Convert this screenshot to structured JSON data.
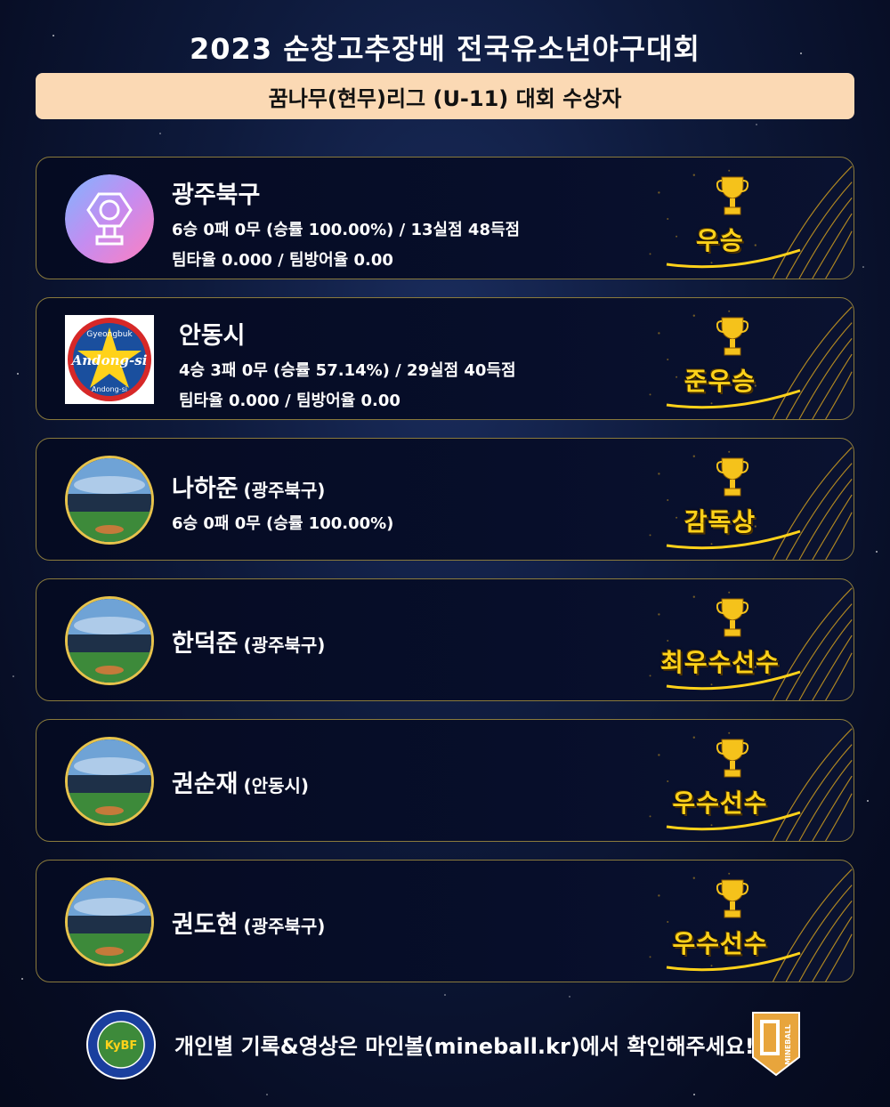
{
  "title": "2023 순창고추장배 전국유소년야구대회",
  "subtitle": "꿈나무(현무)리그 (U-11) 대회 수상자",
  "awards": [
    {
      "name": "광주북구",
      "team": "",
      "line1": "6승 0패 0무 (승률 100.00%) / 13실점 48득점",
      "line2": "팀타율 0.000 / 팀방어율 0.00",
      "award": "우승",
      "avatar": "team-logo-icon"
    },
    {
      "name": "안동시",
      "team": "",
      "line1": "4승 3패 0무 (승률 57.14%) / 29실점 40득점",
      "line2": "팀타율 0.000 / 팀방어율 0.00",
      "award": "준우승",
      "avatar": "andong-logo-icon"
    },
    {
      "name": "나하준",
      "team": "(광주북구)",
      "line1": "6승 0패 0무 (승률 100.00%)",
      "line2": "",
      "award": "감독상",
      "avatar": "stadium-icon"
    },
    {
      "name": "한덕준",
      "team": "(광주북구)",
      "line1": "",
      "line2": "",
      "award": "최우수선수",
      "avatar": "stadium-icon"
    },
    {
      "name": "권순재",
      "team": "(안동시)",
      "line1": "",
      "line2": "",
      "award": "우수선수",
      "avatar": "stadium-icon"
    },
    {
      "name": "권도현",
      "team": "(광주북구)",
      "line1": "",
      "line2": "",
      "award": "우수선수",
      "avatar": "stadium-icon"
    }
  ],
  "andong_logo": {
    "top_text": "Gyeongbuk",
    "main_text": "Andong-si",
    "bottom_text": "Andong-si"
  },
  "footer": {
    "text": "개인별 기록&영상은 마인볼(mineball.kr)에서 확인해주세요!",
    "kybf_logo_text": "KyBF",
    "mineball_logo_text": "MINEBALL"
  },
  "colors": {
    "subtitle_bg": "#fbd9b4",
    "award_text": "#ffd21a",
    "card_border": "#8a7a3c",
    "background": "#0e1a3c"
  }
}
